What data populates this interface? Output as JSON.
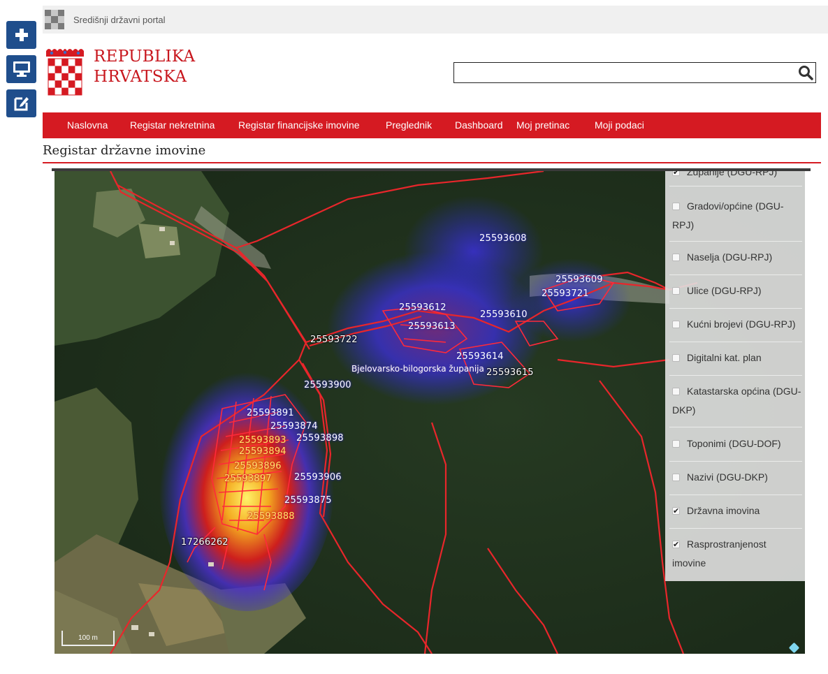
{
  "portal": {
    "name": "Središnji državni portal"
  },
  "brand": {
    "line1": "REPUBLIKA",
    "line2": "HRVATSKA"
  },
  "search": {
    "value": "",
    "placeholder": ""
  },
  "side_tools": [
    {
      "icon": "plus-icon"
    },
    {
      "icon": "monitor-icon"
    },
    {
      "icon": "edit-icon"
    }
  ],
  "nav": {
    "items": [
      {
        "label": "Naslovna"
      },
      {
        "label": "Registar nekretnina"
      },
      {
        "label": "Registar financijske imovine"
      },
      {
        "label": "Preglednik"
      },
      {
        "label": "Dashboard"
      },
      {
        "label": "Moj pretinac"
      },
      {
        "label": "Moji podaci"
      }
    ]
  },
  "page": {
    "title": "Registar državne imovine"
  },
  "map": {
    "county_label": "Bjelovarsko-bilogorska županija",
    "scale_label": "100 m",
    "parcels": [
      "25593608",
      "25593609",
      "25593721",
      "25593612",
      "25593613",
      "25593610",
      "25593722",
      "25593614",
      "25593615",
      "25593900",
      "25593891",
      "25593874",
      "25593893",
      "25593898",
      "25593894",
      "25593896",
      "25593897",
      "25593906",
      "25593875",
      "25593888",
      "17266262"
    ]
  },
  "layers": {
    "items": [
      {
        "label": "Županije (DGU-RPJ)",
        "checked": true
      },
      {
        "label": "Gradovi/općine (DGU-RPJ)",
        "checked": false
      },
      {
        "label": "Naselja (DGU-RPJ)",
        "checked": false
      },
      {
        "label": "Ulice (DGU-RPJ)",
        "checked": false
      },
      {
        "label": "Kućni brojevi (DGU-RPJ)",
        "checked": false
      },
      {
        "label": "Digitalni kat. plan",
        "checked": false
      },
      {
        "label": "Katastarska općina (DGU-DKP)",
        "checked": false
      },
      {
        "label": "Toponimi (DGU-DOF)",
        "checked": false
      },
      {
        "label": "Nazivi (DGU-DKP)",
        "checked": false
      },
      {
        "label": "Državna imovina",
        "checked": true
      },
      {
        "label": "Rasprostranjenost imovine",
        "checked": true
      }
    ]
  },
  "colors": {
    "brand_red": "#d51a22",
    "tool_blue": "#1f4e8c"
  }
}
